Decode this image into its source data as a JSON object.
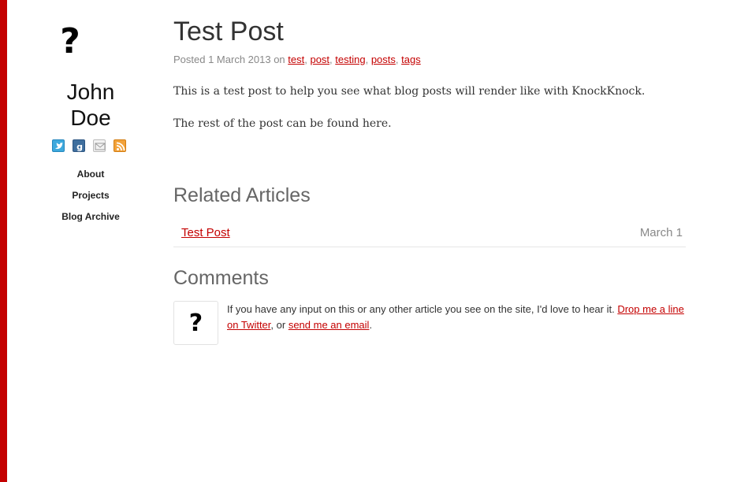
{
  "sidebar": {
    "avatar_glyph": "?",
    "author_first": "John",
    "author_last": "Doe",
    "social": [
      "twitter-icon",
      "gplus-icon",
      "email-icon",
      "rss-icon"
    ],
    "nav": [
      "About",
      "Projects",
      "Blog Archive"
    ]
  },
  "post": {
    "title": "Test Post",
    "posted": "Posted 1 March 2013 on ",
    "tags": [
      "test",
      "post",
      "testing",
      "posts",
      "tags"
    ],
    "paragraph1": "This is a test post to help you see what blog posts will render like with KnockKnock.",
    "paragraph2": "The rest of the post can be found here."
  },
  "related": {
    "heading": "Related Articles",
    "items": [
      {
        "title": "Test Post",
        "date": "March 1"
      }
    ]
  },
  "comments": {
    "heading": "Comments",
    "avatar_glyph": "?",
    "text_before": "If you have any input on this or any other article you see on the site, I'd love to hear it. ",
    "link_twitter": "Drop me a line on Twitter",
    "text_middle": ", or ",
    "link_email": "send me an email",
    "text_end": "."
  },
  "colors": {
    "accent": "#c40000",
    "text": "#333333",
    "muted": "#888888"
  }
}
